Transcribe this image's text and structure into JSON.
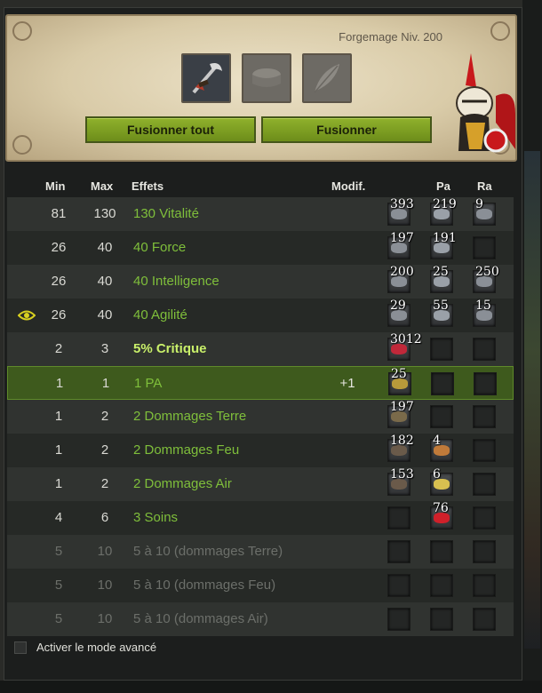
{
  "forge": {
    "level_label": "Forgemage Niv. 200",
    "buttons": {
      "fuse_all": "Fusionner tout",
      "fuse": "Fusionner"
    },
    "slots": [
      "weapon-item-icon",
      "smithing-stone-icon",
      "feather-icon"
    ]
  },
  "table": {
    "headers": {
      "min": "Min",
      "max": "Max",
      "effects": "Effets",
      "modif": "Modif.",
      "pa": "Pa",
      "ra": "Ra"
    },
    "rows": [
      {
        "min": "81",
        "max": "130",
        "effect": "130 Vitalité",
        "modif": "",
        "runes": [
          "393",
          "219",
          "9"
        ]
      },
      {
        "min": "26",
        "max": "40",
        "effect": "40 Force",
        "modif": "",
        "runes": [
          "197",
          "191",
          ""
        ]
      },
      {
        "min": "26",
        "max": "40",
        "effect": "40 Intelligence",
        "modif": "",
        "runes": [
          "200",
          "25",
          "250"
        ]
      },
      {
        "min": "26",
        "max": "40",
        "effect": "40 Agilité",
        "modif": "",
        "runes": [
          "29",
          "55",
          "15"
        ]
      },
      {
        "min": "2",
        "max": "3",
        "effect": "5% Critique",
        "modif": "",
        "runes": [
          "3012",
          "",
          ""
        ]
      },
      {
        "min": "1",
        "max": "1",
        "effect": "1 PA",
        "modif": "+1",
        "runes": [
          "25",
          "",
          ""
        ]
      },
      {
        "min": "1",
        "max": "2",
        "effect": "2 Dommages Terre",
        "modif": "",
        "runes": [
          "197",
          "",
          ""
        ]
      },
      {
        "min": "1",
        "max": "2",
        "effect": "2 Dommages Feu",
        "modif": "",
        "runes": [
          "182",
          "4",
          ""
        ]
      },
      {
        "min": "1",
        "max": "2",
        "effect": "2 Dommages Air",
        "modif": "",
        "runes": [
          "153",
          "6",
          ""
        ]
      },
      {
        "min": "4",
        "max": "6",
        "effect": "3 Soins",
        "modif": "",
        "runes": [
          "",
          "76",
          ""
        ]
      },
      {
        "min": "5",
        "max": "10",
        "effect": "5 à 10 (dommages Terre)",
        "modif": "",
        "runes": [
          "",
          "",
          ""
        ]
      },
      {
        "min": "5",
        "max": "10",
        "effect": "5 à 10 (dommages Feu)",
        "modif": "",
        "runes": [
          "",
          "",
          ""
        ]
      },
      {
        "min": "5",
        "max": "10",
        "effect": "5 à 10 (dommages Air)",
        "modif": "",
        "runes": [
          "",
          "",
          ""
        ]
      }
    ]
  },
  "footer": {
    "advanced_mode_label": "Activer le mode avancé",
    "advanced_mode_checked": false
  },
  "colors": {
    "button_green": "#7fa324",
    "effect_green": "#7fbf3b",
    "highlight_row": "#3e5a1d"
  }
}
